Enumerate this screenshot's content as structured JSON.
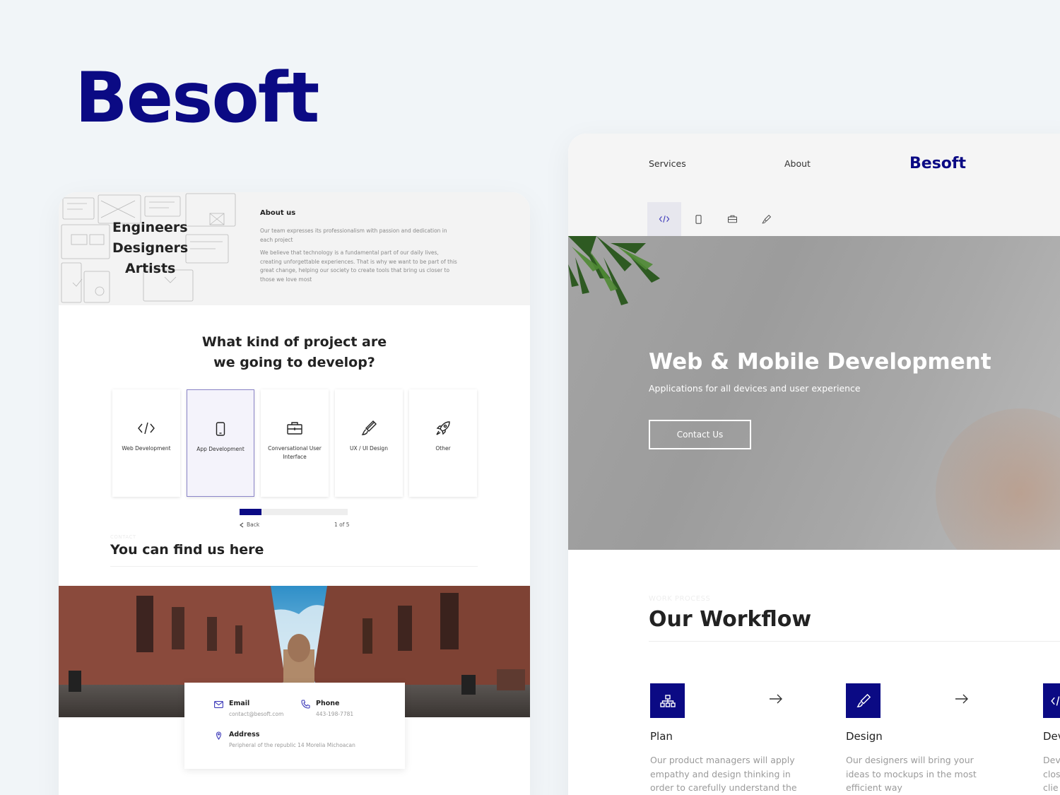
{
  "brand": "Besoft",
  "left_card": {
    "about": {
      "taglines": [
        "Engineers",
        "Designers",
        "Artists"
      ],
      "title": "About us",
      "p1": "Our team expresses its professionalism with passion and dedication in each project",
      "p2": "We believe that technology is a fundamental part of our daily lives, creating unforgettable experiences. That is why we want to be part of this great change, helping our society to create tools that bring us closer to those we love most"
    },
    "question": {
      "line1": "What kind of project are",
      "line2": "we going to develop?"
    },
    "options": [
      {
        "label": "Web Development",
        "icon": "code-icon"
      },
      {
        "label": "App Development",
        "icon": "mobile-icon"
      },
      {
        "label": "Conversational User Interface",
        "icon": "briefcase-icon"
      },
      {
        "label": "UX / UI Design",
        "icon": "brush-icon"
      },
      {
        "label": "Other",
        "icon": "rocket-icon"
      }
    ],
    "selected_option": 1,
    "progress": {
      "fraction": 0.2,
      "back_label": "Back",
      "pager": "1 of 5"
    },
    "contact": {
      "kicker": "CONTACT",
      "title": "You can find us here",
      "email_label": "Email",
      "email_value": "contact@besoft.com",
      "phone_label": "Phone",
      "phone_value": "443-198-7781",
      "address_label": "Address",
      "address_value": "Peripheral of the republic 14 Morelia Michoacan"
    }
  },
  "right_card": {
    "nav": {
      "services": "Services",
      "about": "About",
      "brand": "Besoft"
    },
    "tabs": [
      "code-icon",
      "mobile-icon",
      "briefcase-icon",
      "brush-icon"
    ],
    "hero": {
      "title": "Web & Mobile Development",
      "subtitle": "Applications for all devices and user experience",
      "cta": "Contact Us"
    },
    "workflow": {
      "kicker": "WORK PROCESS",
      "title": "Our Workflow",
      "steps": [
        {
          "name": "Plan",
          "icon": "sitemap-icon",
          "desc": "Our product managers will apply empathy and design thinking in order to carefully understand the"
        },
        {
          "name": "Design",
          "icon": "brush-icon",
          "desc": "Our designers will bring your ideas to mockups in the most efficient way"
        },
        {
          "name": "Dev",
          "icon": "code-icon",
          "desc": "Dev clos clie"
        }
      ]
    }
  },
  "colors": {
    "brand": "#0b0a84",
    "background": "#f1f5f8"
  }
}
